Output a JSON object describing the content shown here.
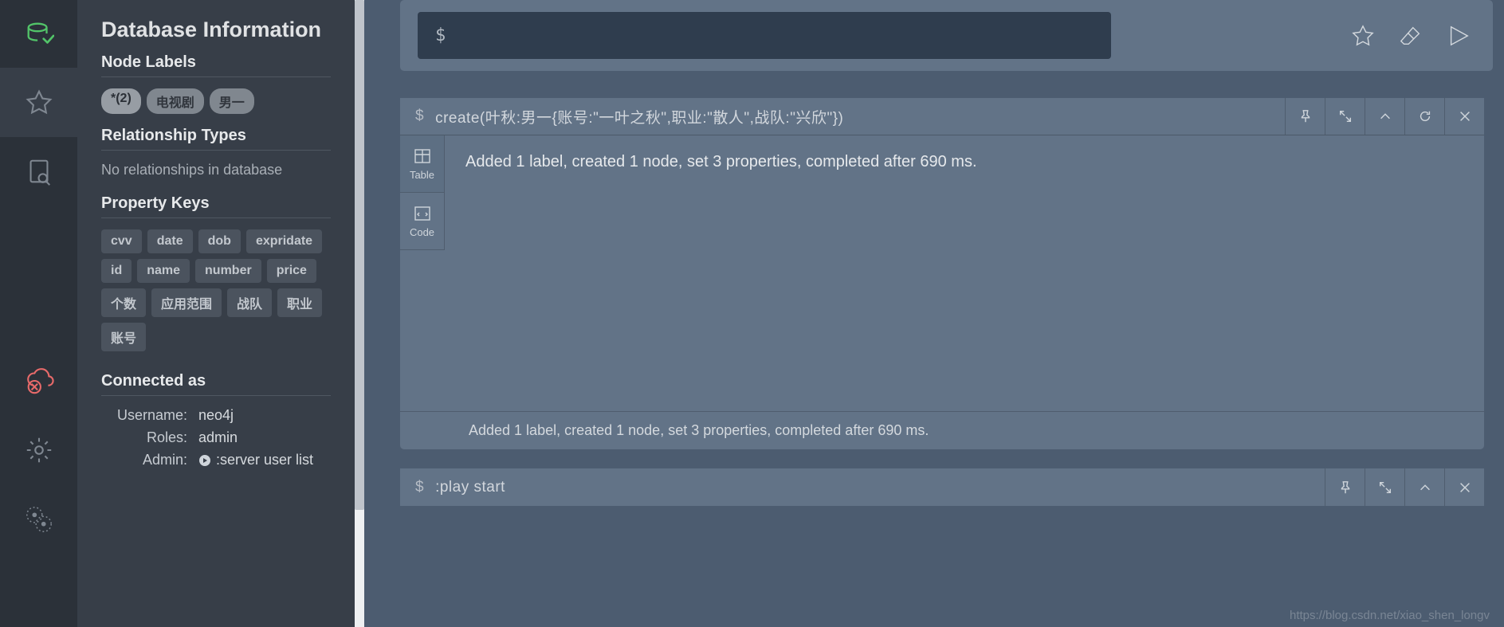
{
  "sidebar": {
    "title": "Database Information",
    "sections": {
      "nodeLabels": {
        "heading": "Node Labels",
        "labels": [
          "*(2)",
          "电视剧",
          "男一"
        ]
      },
      "relTypes": {
        "heading": "Relationship Types",
        "empty": "No relationships in database"
      },
      "propKeys": {
        "heading": "Property Keys",
        "keys": [
          "cvv",
          "date",
          "dob",
          "expridate",
          "id",
          "name",
          "number",
          "price",
          "个数",
          "应用范围",
          "战队",
          "职业",
          "账号"
        ]
      },
      "connected": {
        "heading": "Connected as",
        "usernameLabel": "Username:",
        "username": "neo4j",
        "rolesLabel": "Roles:",
        "roles": "admin",
        "adminLabel": "Admin:",
        "adminCmd": ":server user list"
      }
    }
  },
  "editor": {
    "prompt": "$"
  },
  "viewTabs": {
    "table": "Table",
    "code": "Code"
  },
  "frames": [
    {
      "prompt": "$",
      "command": "create(叶秋:男一{账号:\"一叶之秋\",职业:\"散人\",战队:\"兴欣\"})",
      "message": "Added 1 label, created 1 node, set 3 properties, completed after 690 ms.",
      "footer": "Added 1 label, created 1 node, set 3 properties, completed after 690 ms."
    },
    {
      "prompt": "$",
      "command": ":play start"
    }
  ],
  "watermark": "https://blog.csdn.net/xiao_shen_longv"
}
